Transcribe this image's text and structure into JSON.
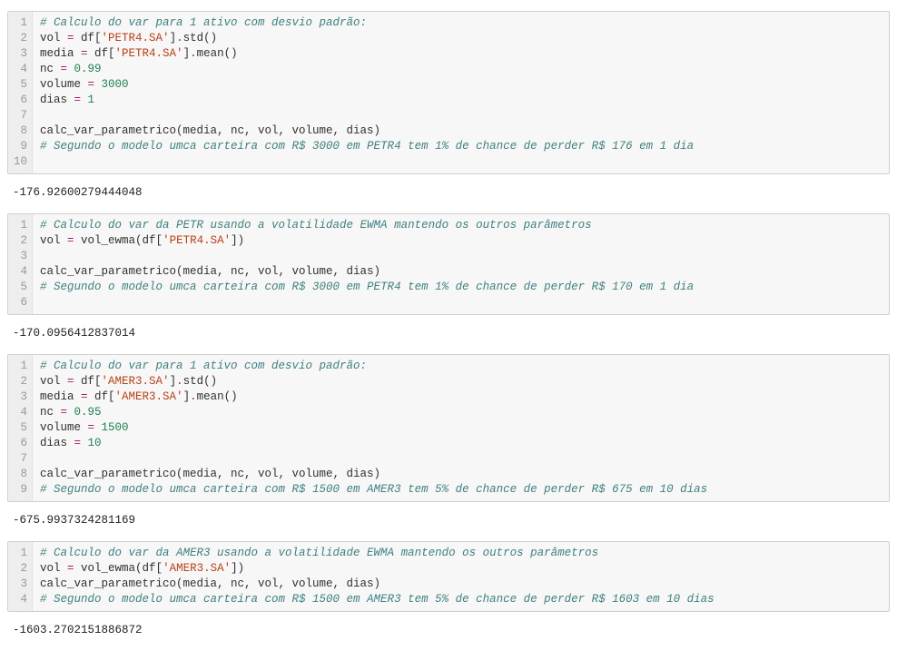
{
  "cells": [
    {
      "lines": [
        [
          [
            "comment",
            "# Calculo do var para 1 ativo com desvio padrão:"
          ]
        ],
        [
          [
            "name",
            "vol "
          ],
          [
            "op",
            "="
          ],
          [
            "name",
            " df["
          ],
          [
            "str",
            "'PETR4.SA'"
          ],
          [
            "name",
            "]"
          ],
          [
            "op",
            "."
          ],
          [
            "name",
            "std()"
          ]
        ],
        [
          [
            "name",
            "media "
          ],
          [
            "op",
            "="
          ],
          [
            "name",
            " df["
          ],
          [
            "str",
            "'PETR4.SA'"
          ],
          [
            "name",
            "]"
          ],
          [
            "op",
            "."
          ],
          [
            "name",
            "mean()"
          ]
        ],
        [
          [
            "name",
            "nc "
          ],
          [
            "op",
            "="
          ],
          [
            "name",
            " "
          ],
          [
            "num",
            "0.99"
          ]
        ],
        [
          [
            "name",
            "volume "
          ],
          [
            "op",
            "="
          ],
          [
            "name",
            " "
          ],
          [
            "num",
            "3000"
          ]
        ],
        [
          [
            "name",
            "dias "
          ],
          [
            "op",
            "="
          ],
          [
            "name",
            " "
          ],
          [
            "num",
            "1"
          ]
        ],
        [
          [
            "name",
            ""
          ]
        ],
        [
          [
            "name",
            "calc_var_parametrico(media, nc, vol, volume, dias)"
          ]
        ],
        [
          [
            "comment",
            "# Segundo o modelo umca carteira com R$ 3000 em PETR4 tem 1% de chance de perder R$ 176 em 1 dia"
          ]
        ],
        [
          [
            "name",
            ""
          ]
        ]
      ],
      "output": "-176.92600279444048"
    },
    {
      "lines": [
        [
          [
            "comment",
            "# Calculo do var da PETR usando a volatilidade EWMA mantendo os outros parâmetros"
          ]
        ],
        [
          [
            "name",
            "vol "
          ],
          [
            "op",
            "="
          ],
          [
            "name",
            " vol_ewma(df["
          ],
          [
            "str",
            "'PETR4.SA'"
          ],
          [
            "name",
            "])"
          ]
        ],
        [
          [
            "name",
            ""
          ]
        ],
        [
          [
            "name",
            "calc_var_parametrico(media, nc, vol, volume, dias)"
          ]
        ],
        [
          [
            "comment",
            "# Segundo o modelo umca carteira com R$ 3000 em PETR4 tem 1% de chance de perder R$ 170 em 1 dia"
          ]
        ],
        [
          [
            "name",
            ""
          ]
        ]
      ],
      "output": "-170.0956412837014"
    },
    {
      "lines": [
        [
          [
            "comment",
            "# Calculo do var para 1 ativo com desvio padrão:"
          ]
        ],
        [
          [
            "name",
            "vol "
          ],
          [
            "op",
            "="
          ],
          [
            "name",
            " df["
          ],
          [
            "str",
            "'AMER3.SA'"
          ],
          [
            "name",
            "]"
          ],
          [
            "op",
            "."
          ],
          [
            "name",
            "std()"
          ]
        ],
        [
          [
            "name",
            "media "
          ],
          [
            "op",
            "="
          ],
          [
            "name",
            " df["
          ],
          [
            "str",
            "'AMER3.SA'"
          ],
          [
            "name",
            "]"
          ],
          [
            "op",
            "."
          ],
          [
            "name",
            "mean()"
          ]
        ],
        [
          [
            "name",
            "nc "
          ],
          [
            "op",
            "="
          ],
          [
            "name",
            " "
          ],
          [
            "num",
            "0.95"
          ]
        ],
        [
          [
            "name",
            "volume "
          ],
          [
            "op",
            "="
          ],
          [
            "name",
            " "
          ],
          [
            "num",
            "1500"
          ]
        ],
        [
          [
            "name",
            "dias "
          ],
          [
            "op",
            "="
          ],
          [
            "name",
            " "
          ],
          [
            "num",
            "10"
          ]
        ],
        [
          [
            "name",
            ""
          ]
        ],
        [
          [
            "name",
            "calc_var_parametrico(media, nc, vol, volume, dias)"
          ]
        ],
        [
          [
            "comment",
            "# Segundo o modelo umca carteira com R$ 1500 em AMER3 tem 5% de chance de perder R$ 675 em 10 dias"
          ]
        ]
      ],
      "output": "-675.9937324281169"
    },
    {
      "lines": [
        [
          [
            "comment",
            "# Calculo do var da AMER3 usando a volatilidade EWMA mantendo os outros parâmetros"
          ]
        ],
        [
          [
            "name",
            "vol "
          ],
          [
            "op",
            "="
          ],
          [
            "name",
            " vol_ewma(df["
          ],
          [
            "str",
            "'AMER3.SA'"
          ],
          [
            "name",
            "])"
          ]
        ],
        [
          [
            "name",
            "calc_var_parametrico(media, nc, vol, volume, dias)"
          ]
        ],
        [
          [
            "comment",
            "# Segundo o modelo umca carteira com R$ 1500 em AMER3 tem 5% de chance de perder R$ 1603 em 10 dias"
          ]
        ]
      ],
      "output": "-1603.2702151886872"
    }
  ]
}
